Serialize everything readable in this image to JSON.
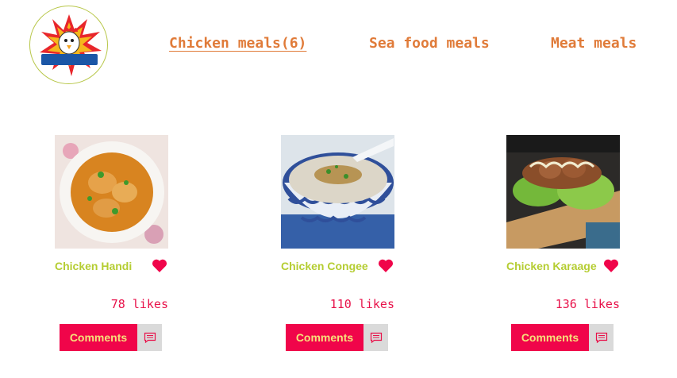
{
  "header": {
    "logo_text": "WOW CHICKEN",
    "nav": [
      {
        "label": "Chicken meals(6)",
        "active": true
      },
      {
        "label": "Sea food meals",
        "active": false
      },
      {
        "label": "Meat meals",
        "active": false
      }
    ]
  },
  "meals": [
    {
      "name": "Chicken Handi",
      "likes": "78 likes",
      "comments_label": "Comments",
      "like_icon": "heart-icon",
      "comment_icon": "comment-icon"
    },
    {
      "name": "Chicken Congee",
      "likes": "110 likes",
      "comments_label": "Comments",
      "like_icon": "heart-icon",
      "comment_icon": "comment-icon"
    },
    {
      "name": "Chicken Karaage",
      "likes": "136 likes",
      "comments_label": "Comments",
      "like_icon": "heart-icon",
      "comment_icon": "comment-icon"
    }
  ],
  "colors": {
    "nav": "#e07b39",
    "meal_name": "#b5cd32",
    "likes": "#e8124a",
    "heart": "#f0054a",
    "button_bg": "#f0054a",
    "button_text": "#f6e07a",
    "button_icon_bg": "#dadada"
  }
}
